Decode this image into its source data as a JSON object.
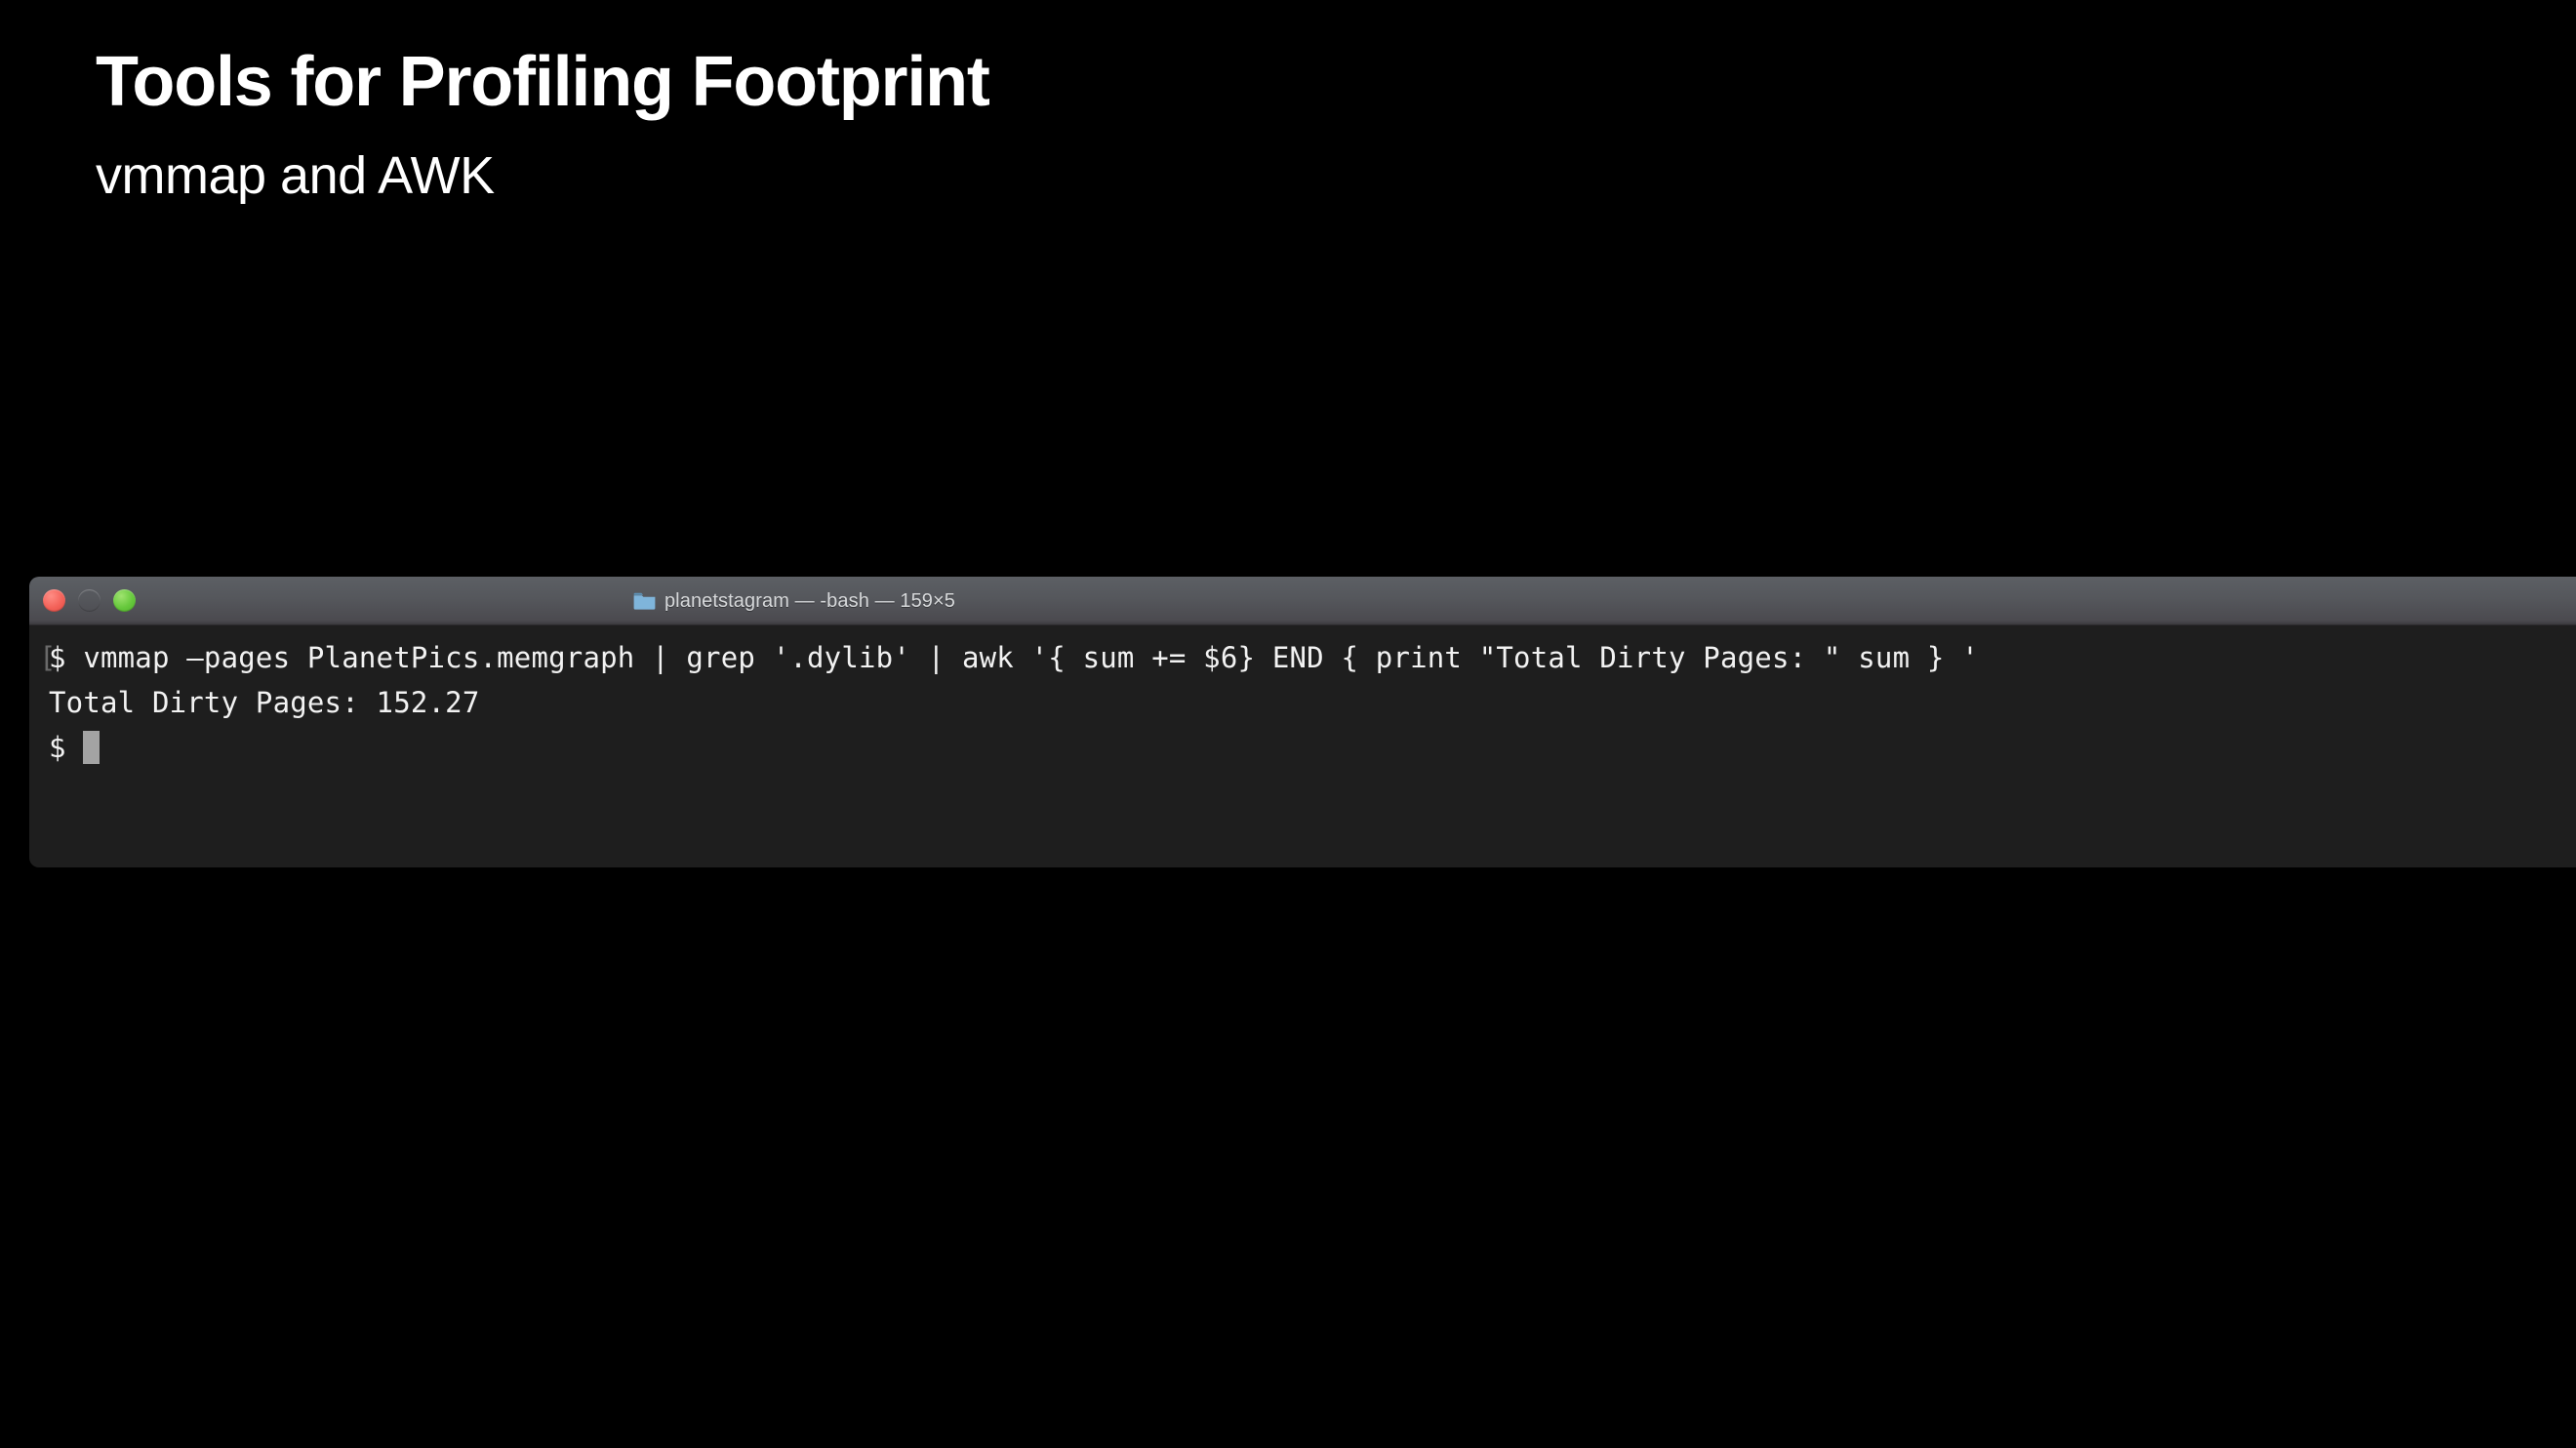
{
  "slide": {
    "title": "Tools for Profiling Footprint",
    "subtitle": "vmmap and AWK",
    "background_color": "#000000",
    "text_color": "#ffffff"
  },
  "terminal": {
    "titlebar": {
      "title": "planetstagram — -bash — 159×5",
      "folder_icon": "folder-icon",
      "folder_icon_color": "#7fb5db",
      "buttons": [
        {
          "name": "close",
          "icon": "close-traffic-light",
          "color": "#f36259"
        },
        {
          "name": "minimize",
          "icon": "minimize-traffic-light",
          "color": "#e9c94f"
        },
        {
          "name": "zoom",
          "icon": "zoom-traffic-light",
          "color": "#66c83c"
        }
      ]
    },
    "background_color": "#1e1e1e",
    "foreground_color": "#f2f2f2",
    "cursor_color": "#a3a3a3",
    "leading_bracket": "[",
    "lines": [
      "$ vmmap —pages PlanetPics.memgraph | grep '.dylib' | awk '{ sum += $6} END { print \"Total Dirty Pages: \" sum } '",
      "Total Dirty Pages: 152.27",
      "$ "
    ]
  }
}
